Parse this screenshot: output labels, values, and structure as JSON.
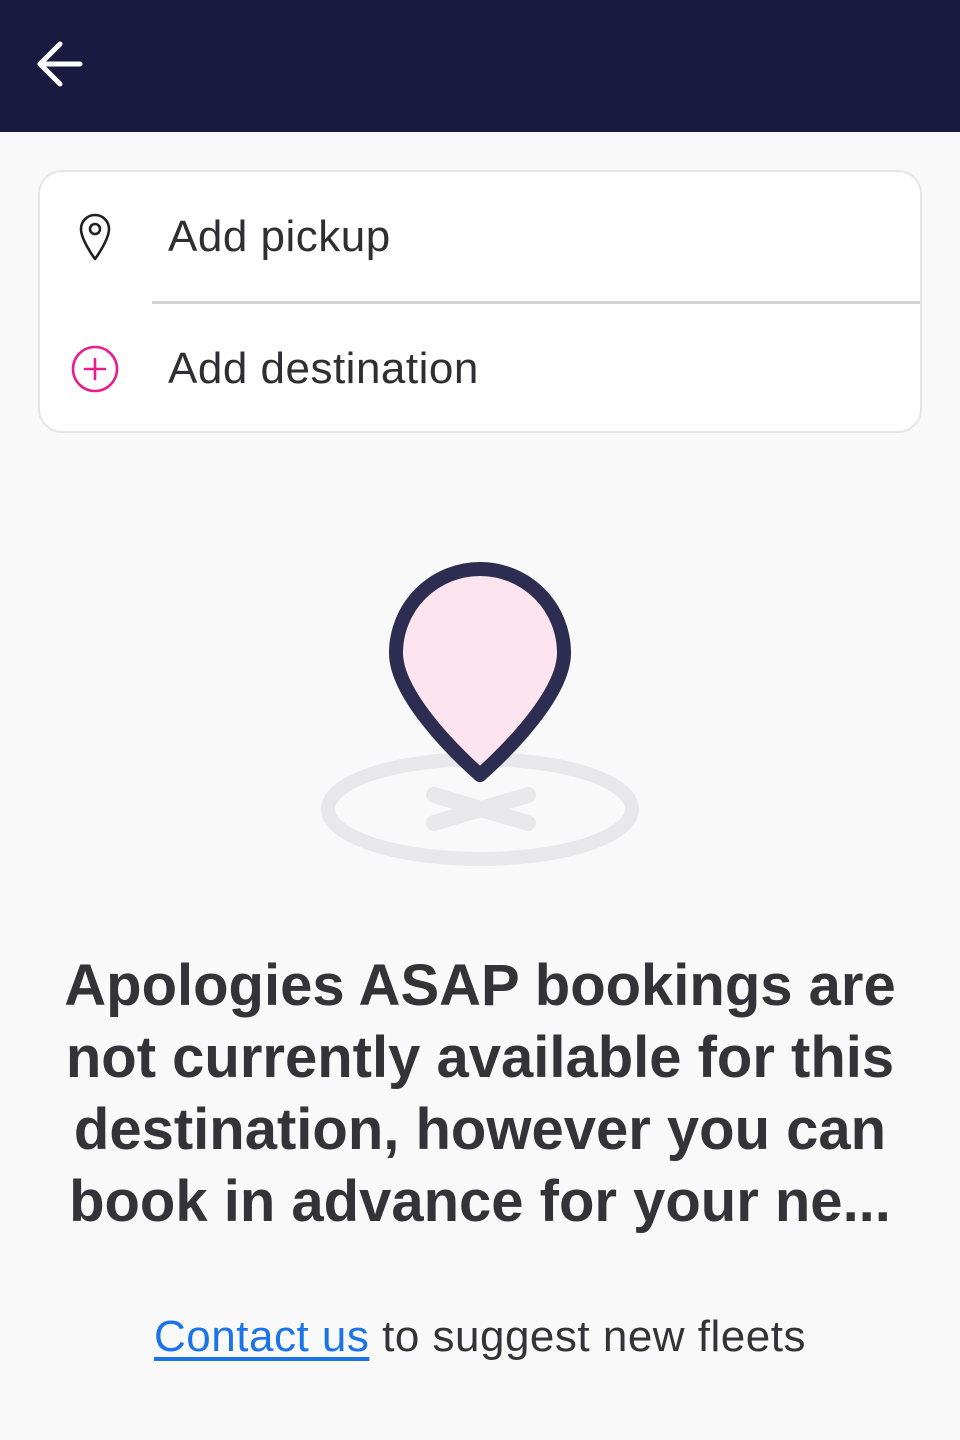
{
  "header": {
    "back_icon": "arrow-left-icon",
    "background_color": "#1a1a40"
  },
  "route": {
    "pickup": {
      "label": "Add pickup",
      "icon": "map-pin-outline-icon"
    },
    "destination": {
      "label": "Add destination",
      "icon": "plus-circle-icon",
      "icon_color": "#e91e8c"
    }
  },
  "empty_state": {
    "illustration": "location-pin-illustration",
    "message": "Apologies ASAP bookings are not currently available for this destination, however you can book in advance for your ne..."
  },
  "footer": {
    "link_text": "Contact us",
    "text": " to suggest new fleets",
    "link_color": "#1a73e8"
  }
}
